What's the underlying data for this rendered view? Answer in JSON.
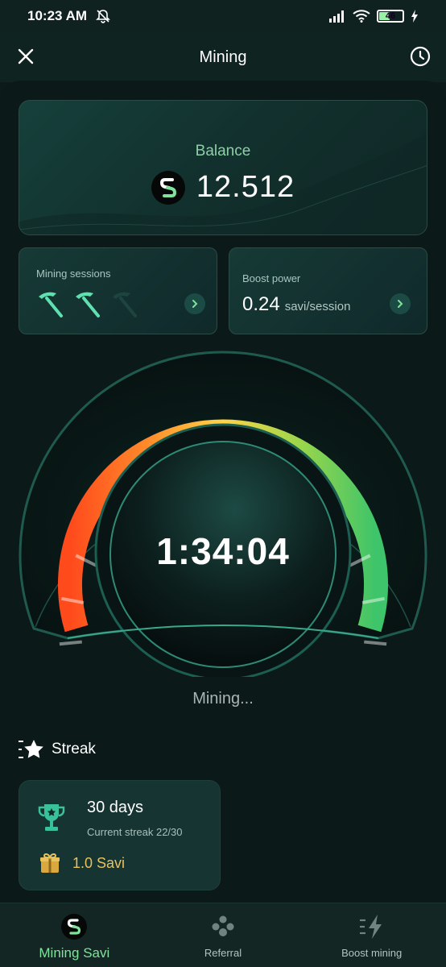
{
  "status_bar": {
    "time": "10:23 AM",
    "battery": "46"
  },
  "header": {
    "title": "Mining"
  },
  "balance": {
    "label": "Balance",
    "value": "12.512"
  },
  "mining_sessions": {
    "label": "Mining sessions",
    "total": 3,
    "used": 2
  },
  "boost_power": {
    "label": "Boost power",
    "value": "0.24",
    "unit": "savi/session"
  },
  "timer": {
    "value": "1:34:04"
  },
  "mining_status": "Mining...",
  "streak": {
    "title": "Streak",
    "days": "30 days",
    "current": "Current streak 22/30",
    "reward": "1.0 Savi"
  },
  "nav": [
    {
      "label": "Mining Savi",
      "icon": "savi-logo-icon",
      "active": true
    },
    {
      "label": "Referral",
      "icon": "users-icon",
      "active": false
    },
    {
      "label": "Boost mining",
      "icon": "lightning-icon",
      "active": false
    }
  ],
  "colors": {
    "accent": "#7fe39b",
    "background": "#0b1918",
    "gold": "#e9c25c"
  }
}
